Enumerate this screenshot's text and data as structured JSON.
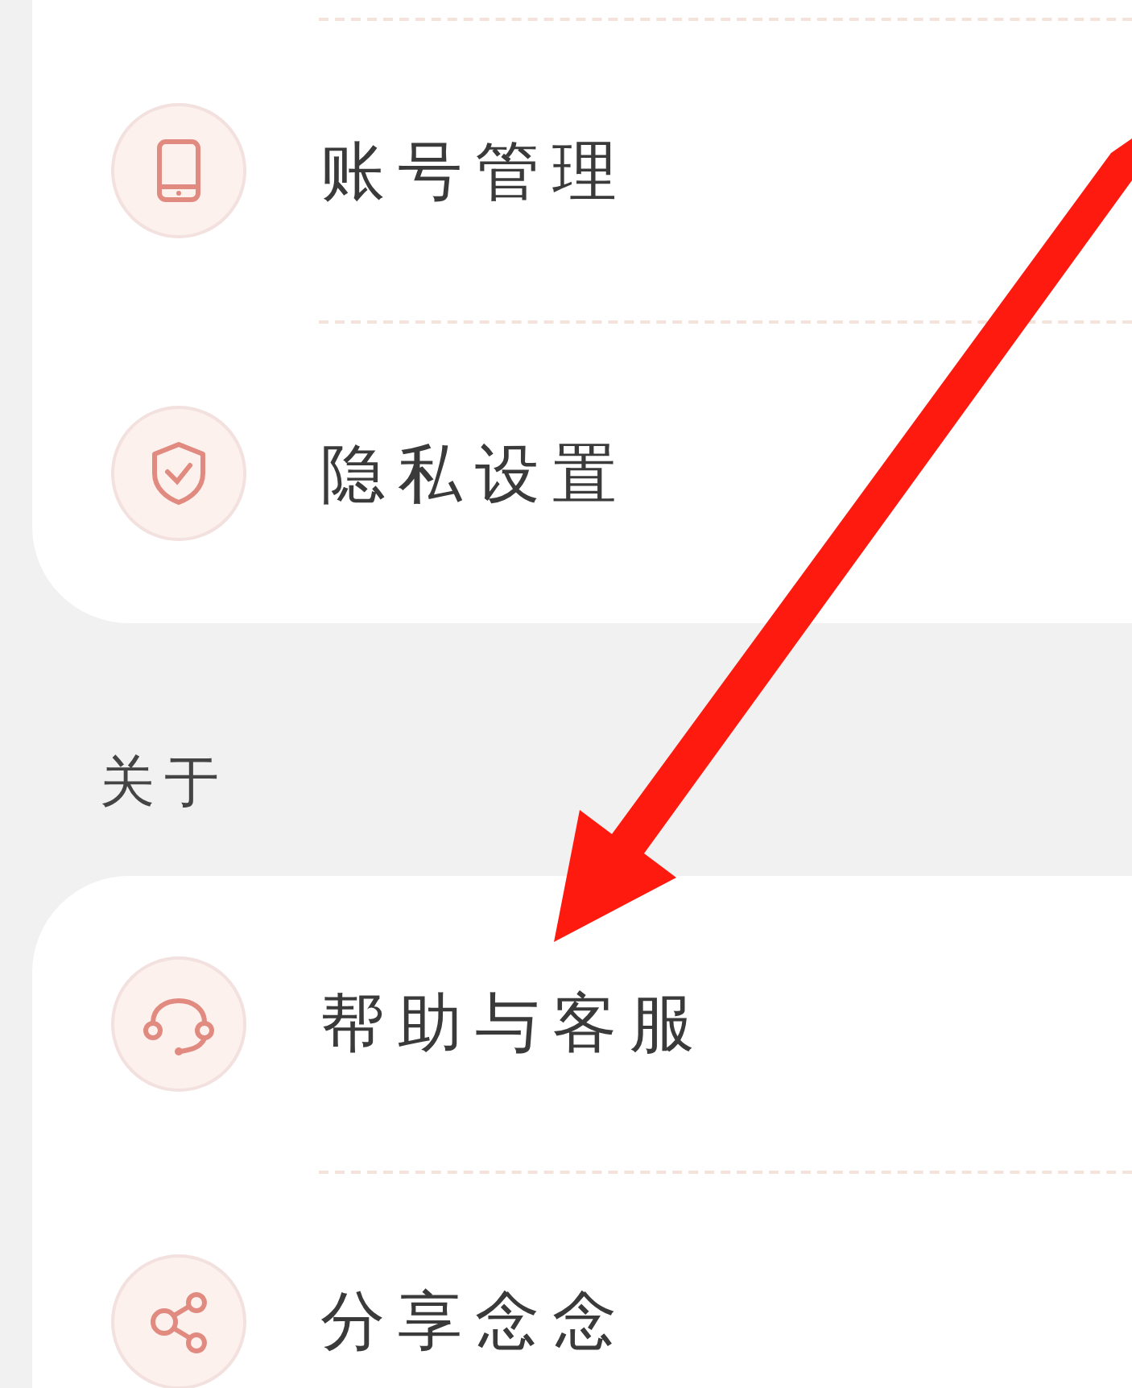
{
  "sections": [
    {
      "items": [
        {
          "label": "账号管理",
          "kind": "phone"
        },
        {
          "label": "隐私设置",
          "kind": "shield"
        }
      ]
    },
    {
      "title": "关于",
      "items": [
        {
          "label": "帮助与客服",
          "kind": "headset"
        },
        {
          "label": "分享念念",
          "kind": "share"
        }
      ]
    }
  ],
  "annotation_arrow": {
    "color": "#ff1a10"
  }
}
